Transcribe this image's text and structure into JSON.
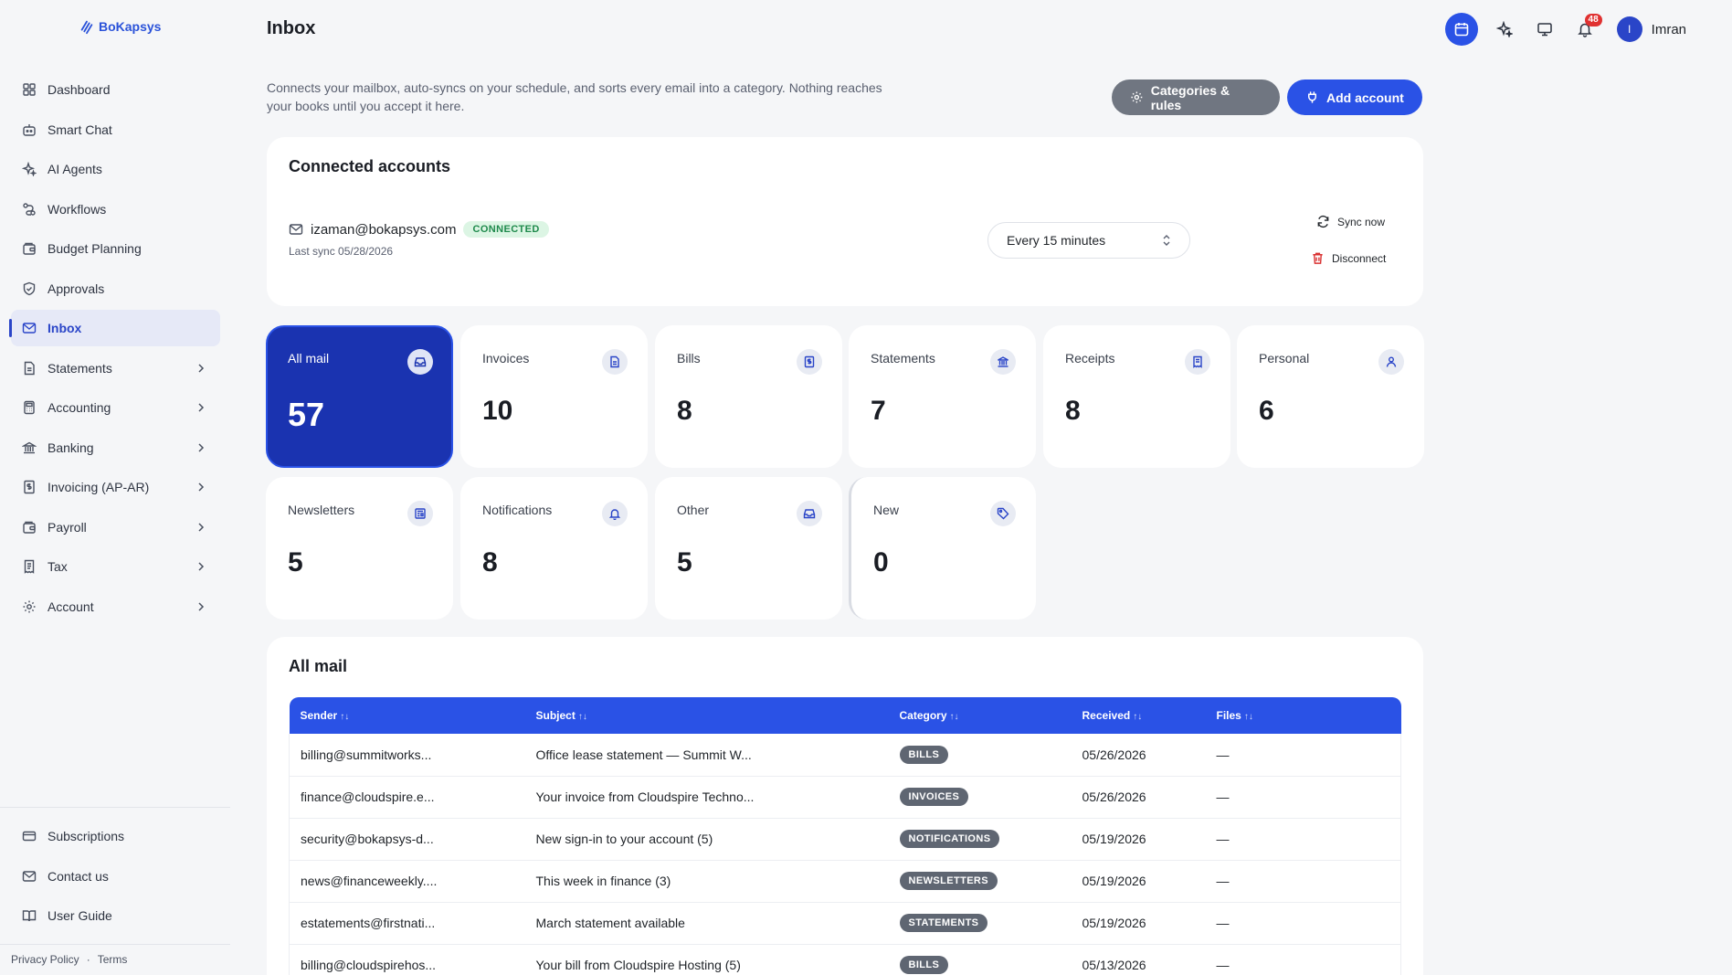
{
  "app": {
    "logo_text": "BoKapsys"
  },
  "sidebar": {
    "items": [
      {
        "label": "Dashboard",
        "icon": "grid-icon"
      },
      {
        "label": "Smart Chat",
        "icon": "chat-bot-icon"
      },
      {
        "label": "AI Agents",
        "icon": "sparkles-icon"
      },
      {
        "label": "Workflows",
        "icon": "workflow-icon"
      },
      {
        "label": "Budget Planning",
        "icon": "wallet-icon"
      },
      {
        "label": "Approvals",
        "icon": "shield-check-icon"
      },
      {
        "label": "Inbox",
        "icon": "mail-icon",
        "active": true
      },
      {
        "label": "Statements",
        "icon": "document-icon",
        "expandable": true
      },
      {
        "label": "Accounting",
        "icon": "calculator-icon",
        "expandable": true
      },
      {
        "label": "Banking",
        "icon": "bank-icon",
        "expandable": true
      },
      {
        "label": "Invoicing (AP-AR)",
        "icon": "invoice-icon",
        "expandable": true
      },
      {
        "label": "Payroll",
        "icon": "wallet-icon",
        "expandable": true
      },
      {
        "label": "Tax",
        "icon": "receipt-icon",
        "expandable": true
      },
      {
        "label": "Account",
        "icon": "gear-icon",
        "expandable": true
      }
    ],
    "bottom_items": [
      {
        "label": "Subscriptions",
        "icon": "credit-card-icon"
      },
      {
        "label": "Contact us",
        "icon": "mail-icon"
      },
      {
        "label": "User Guide",
        "icon": "book-icon"
      }
    ],
    "footer": {
      "privacy": "Privacy Policy",
      "separator": "·",
      "terms": "Terms"
    }
  },
  "header": {
    "title": "Inbox",
    "notification_count": "48",
    "user_initial": "I",
    "user_name": "Imran"
  },
  "intro": {
    "description": "Connects your mailbox, auto-syncs on your schedule, and sorts every email into a category. Nothing reaches your books until you accept it here.",
    "categories_button": "Categories & rules",
    "add_account_button": "Add account"
  },
  "connected_accounts": {
    "title": "Connected accounts",
    "email": "izaman@bokapsys.com",
    "status": "CONNECTED",
    "last_sync": "Last sync 05/28/2026",
    "sync_interval": "Every 15 minutes",
    "sync_now": "Sync now",
    "disconnect": "Disconnect"
  },
  "tiles": [
    {
      "label": "All mail",
      "value": "57",
      "icon": "inbox-icon",
      "active": true
    },
    {
      "label": "Invoices",
      "value": "10",
      "icon": "file-icon"
    },
    {
      "label": "Bills",
      "value": "8",
      "icon": "dollar-doc-icon"
    },
    {
      "label": "Statements",
      "value": "7",
      "icon": "bank-icon"
    },
    {
      "label": "Receipts",
      "value": "8",
      "icon": "receipt-icon"
    },
    {
      "label": "Personal",
      "value": "6",
      "icon": "user-icon"
    },
    {
      "label": "Newsletters",
      "value": "5",
      "icon": "newspaper-icon"
    },
    {
      "label": "Notifications",
      "value": "8",
      "icon": "bell-icon"
    },
    {
      "label": "Other",
      "value": "5",
      "icon": "inbox-icon"
    },
    {
      "label": "New",
      "value": "0",
      "icon": "tag-icon"
    }
  ],
  "mail": {
    "title": "All mail",
    "columns": [
      "Sender",
      "Subject",
      "Category",
      "Received",
      "Files"
    ],
    "sort_glyph": "↑↓",
    "rows": [
      {
        "sender": "billing@summitworks...",
        "subject": "Office lease statement — Summit W...",
        "category": "BILLS",
        "received": "05/26/2026",
        "files": "—"
      },
      {
        "sender": "finance@cloudspire.e...",
        "subject": "Your invoice from Cloudspire Techno...",
        "category": "INVOICES",
        "received": "05/26/2026",
        "files": "—"
      },
      {
        "sender": "security@bokapsys-d...",
        "subject": "New sign-in to your account (5)",
        "category": "NOTIFICATIONS",
        "received": "05/19/2026",
        "files": "—"
      },
      {
        "sender": "news@financeweekly....",
        "subject": "This week in finance (3)",
        "category": "NEWSLETTERS",
        "received": "05/19/2026",
        "files": "—"
      },
      {
        "sender": "estatements@firstnati...",
        "subject": "March statement available",
        "category": "STATEMENTS",
        "received": "05/19/2026",
        "files": "—"
      },
      {
        "sender": "billing@cloudspirehos...",
        "subject": "Your bill from Cloudspire Hosting (5)",
        "category": "BILLS",
        "received": "05/13/2026",
        "files": "—"
      }
    ]
  }
}
